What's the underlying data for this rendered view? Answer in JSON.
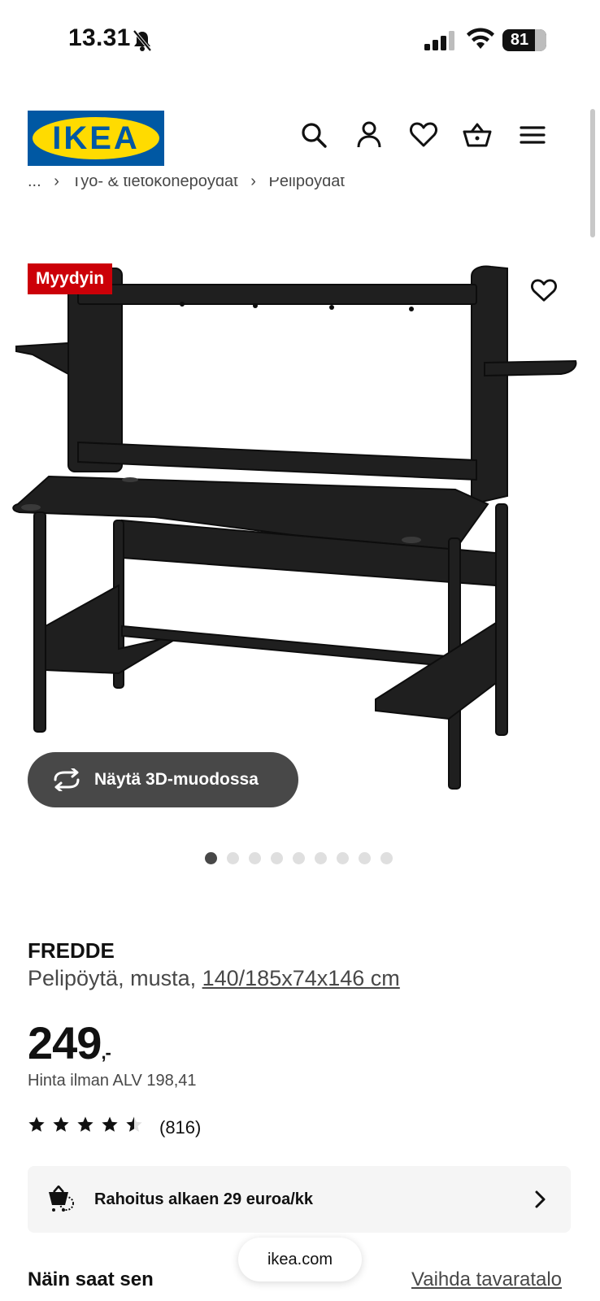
{
  "status_bar": {
    "time": "13.31",
    "battery": "81",
    "battery_level": 0.81,
    "icons": [
      "bell-muted-icon",
      "signal-icon",
      "wifi-icon",
      "battery-icon"
    ]
  },
  "header": {
    "logo_text": "IKEA",
    "brand_colors": {
      "blue": "#0058a3",
      "yellow": "#ffdb00"
    },
    "icons": [
      "search-icon",
      "account-icon",
      "heart-icon",
      "cart-icon",
      "menu-icon"
    ]
  },
  "breadcrumb": {
    "items": [
      "...",
      "›",
      "Työ- & tietokonepöydät",
      "›",
      "Pelipöydät"
    ]
  },
  "product": {
    "badge": "Myydyin",
    "badge_color": "#cc0008",
    "view_3d_label": "Näytä 3D-muodossa",
    "image_count": 9,
    "active_image": 1,
    "name": "FREDDE",
    "description": "Pelipöytä, musta, ",
    "dimensions": "140/185x74x146 cm",
    "price": "249",
    "price_suffix": ",-",
    "vat_price": "Hinta ilman ALV 198,41",
    "rating": 4.5,
    "review_count": "(816)"
  },
  "finance": {
    "label": "Rahoitus alkaen 29 euroa/kk"
  },
  "delivery": {
    "title": "Näin saat sen",
    "change_store": "Vaihda tavaratalo"
  },
  "browser": {
    "url": "ikea.com"
  }
}
